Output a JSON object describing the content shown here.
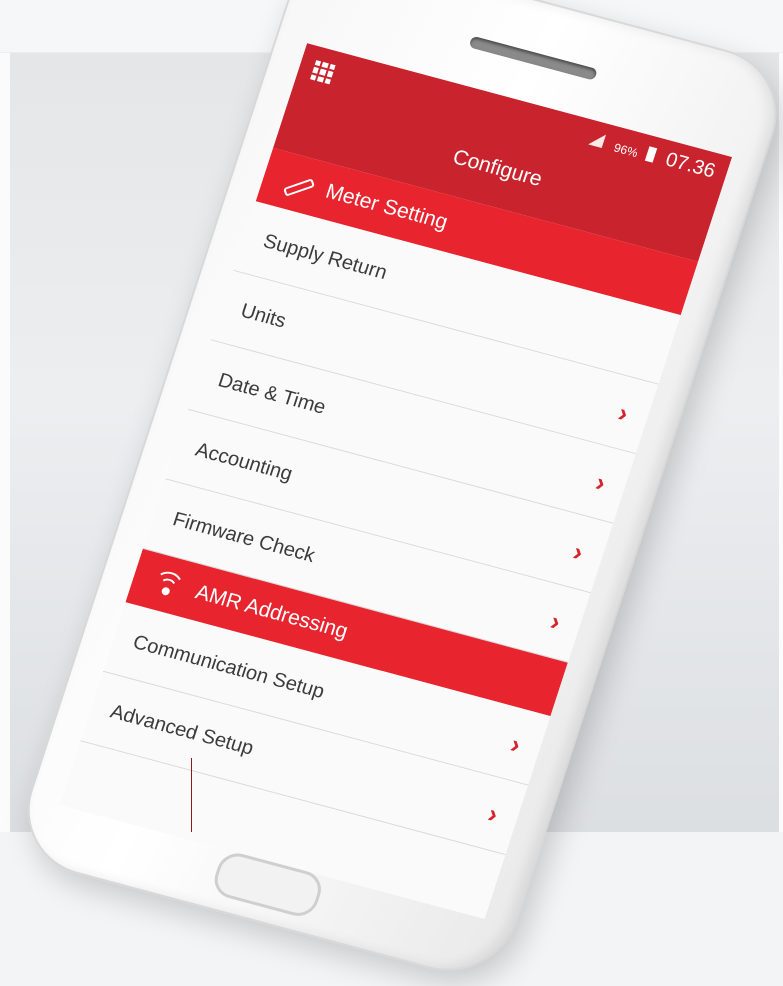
{
  "status_bar": {
    "battery_percent": "96%",
    "time": "07.36"
  },
  "app_bar": {
    "title": "Configure"
  },
  "sections": [
    {
      "label": "Meter Setting",
      "icon": "wrench-icon",
      "items": [
        {
          "label": "Supply Return",
          "chevron": false
        },
        {
          "label": "Units",
          "chevron": true
        },
        {
          "label": "Date & Time",
          "chevron": true
        },
        {
          "label": "Accounting",
          "chevron": true
        },
        {
          "label": "Firmware Check",
          "chevron": true
        }
      ]
    },
    {
      "label": "AMR Addressing",
      "icon": "wifi-icon",
      "items": [
        {
          "label": "Communication Setup",
          "chevron": true
        },
        {
          "label": "Advanced Setup",
          "chevron": true
        }
      ]
    }
  ],
  "colors": {
    "accent": "#e8242f",
    "app_bar": "#c9242e",
    "chevron": "#d4242c"
  },
  "chevron_glyph": "›"
}
